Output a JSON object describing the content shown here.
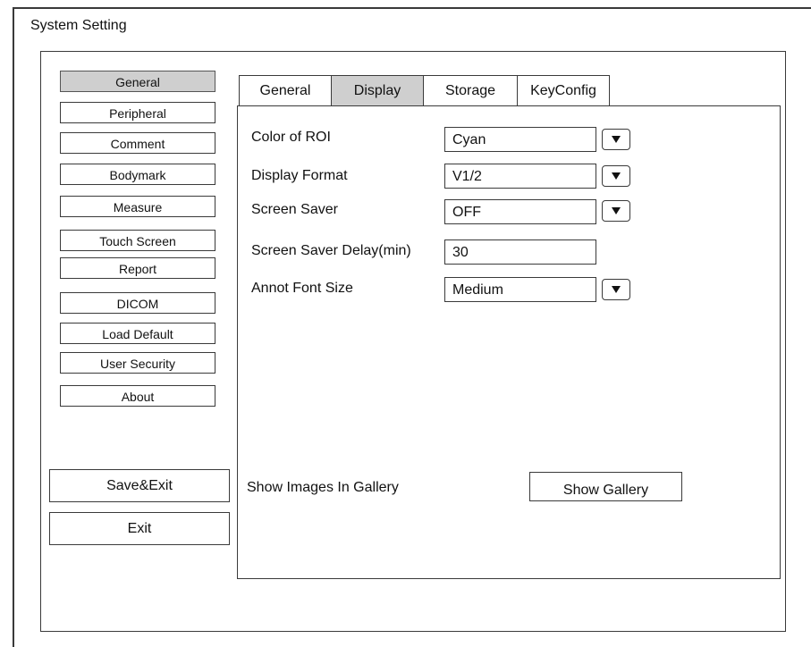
{
  "window": {
    "title": "System Setting"
  },
  "sidebar": {
    "items": [
      {
        "label": "General",
        "active": true
      },
      {
        "label": "Peripheral",
        "active": false
      },
      {
        "label": "Comment",
        "active": false
      },
      {
        "label": "Bodymark",
        "active": false
      },
      {
        "label": "Measure",
        "active": false
      },
      {
        "label": "Touch Screen",
        "active": false
      },
      {
        "label": "Report",
        "active": false
      },
      {
        "label": "DICOM",
        "active": false
      },
      {
        "label": "Load Default",
        "active": false
      },
      {
        "label": "User Security",
        "active": false
      },
      {
        "label": "About",
        "active": false
      }
    ],
    "save_exit_label": "Save&Exit",
    "exit_label": "Exit"
  },
  "tabs": [
    {
      "label": "General",
      "active": false
    },
    {
      "label": "Display",
      "active": true
    },
    {
      "label": "Storage",
      "active": false
    },
    {
      "label": "KeyConfig",
      "active": false
    }
  ],
  "display": {
    "color_of_roi": {
      "label": "Color of ROI",
      "value": "Cyan"
    },
    "display_format": {
      "label": "Display Format",
      "value": "V1/2"
    },
    "screen_saver": {
      "label": "Screen Saver",
      "value": "OFF"
    },
    "screen_saver_delay": {
      "label": "Screen Saver Delay(min)",
      "value": "30"
    },
    "annot_font_size": {
      "label": "Annot Font Size",
      "value": "Medium"
    },
    "gallery_label": "Show Images In Gallery",
    "gallery_button": "Show Gallery"
  },
  "colors": {
    "active_bg": "#cfcfcf",
    "border": "#3a3a3a"
  },
  "icons": {
    "dropdown": "triangle-down-icon"
  }
}
